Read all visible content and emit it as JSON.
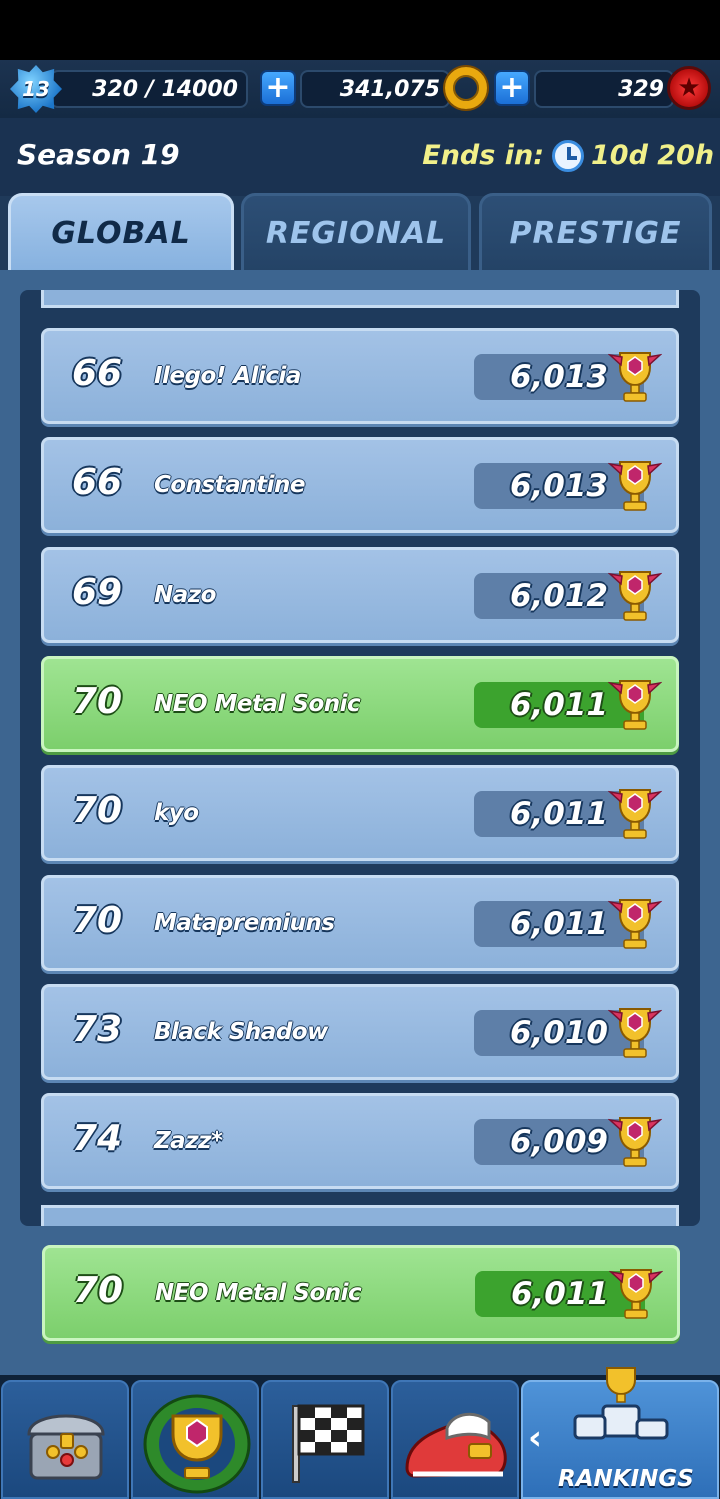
{
  "header": {
    "level": "13",
    "xp": "320 / 14000",
    "rings": "341,075",
    "red_stars": "329"
  },
  "season": {
    "title": "Season 19",
    "ends_label": "Ends in:",
    "time_left": "10d 20h"
  },
  "tabs": [
    {
      "label": "GLOBAL",
      "active": true
    },
    {
      "label": "REGIONAL",
      "active": false
    },
    {
      "label": "PRESTIGE",
      "active": false
    }
  ],
  "leaderboard": [
    {
      "rank": "66",
      "name": "Ilego! Alicia",
      "score": "6,013",
      "highlight": false
    },
    {
      "rank": "66",
      "name": "Constantine",
      "score": "6,013",
      "highlight": false
    },
    {
      "rank": "69",
      "name": "Nazo",
      "score": "6,012",
      "highlight": false
    },
    {
      "rank": "70",
      "name": "NEO Metal Sonic",
      "score": "6,011",
      "highlight": true
    },
    {
      "rank": "70",
      "name": "kyo",
      "score": "6,011",
      "highlight": false
    },
    {
      "rank": "70",
      "name": "Matapremiuns",
      "score": "6,011",
      "highlight": false
    },
    {
      "rank": "73",
      "name": "Black Shadow",
      "score": "6,010",
      "highlight": false
    },
    {
      "rank": "74",
      "name": "Zazz*",
      "score": "6,009",
      "highlight": false
    }
  ],
  "my_entry": {
    "rank": "70",
    "name": "NEO Metal Sonic",
    "score": "6,011"
  },
  "bottom_nav": {
    "items": [
      {
        "icon": "treasure-chest-icon"
      },
      {
        "icon": "trophy-wreath-icon"
      },
      {
        "icon": "checkered-flag-icon"
      },
      {
        "icon": "sneaker-icon"
      },
      {
        "icon": "podium-icon",
        "label": "RANKINGS"
      }
    ],
    "rankings_label": "RANKINGS"
  },
  "colors": {
    "highlight": "#7ccf6c",
    "row": "#8cb1da",
    "accent_yellow": "#f1f08a"
  }
}
